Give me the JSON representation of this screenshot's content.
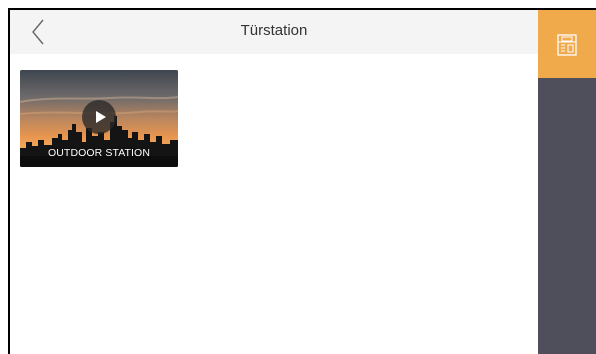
{
  "app": {
    "title": "Türstation"
  },
  "tiles": [
    {
      "label": "OUTDOOR STATION",
      "icon": "play-icon"
    }
  ],
  "sidebar": {
    "items": [
      {
        "icon": "door-station-icon",
        "active": true
      }
    ]
  },
  "colors": {
    "accent": "#f0a94b",
    "sidebar_bg": "#4e4f5a",
    "header_bg": "#f4f4f4",
    "title_text": "#333333"
  }
}
